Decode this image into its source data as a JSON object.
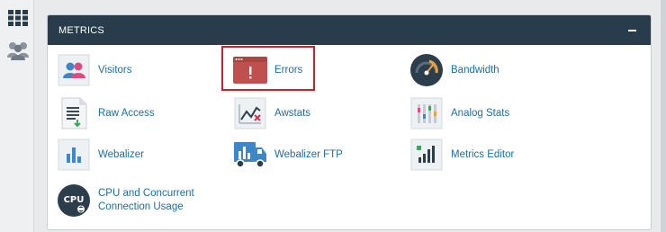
{
  "sidebar": {
    "items": [
      {
        "icon": "grid-icon"
      },
      {
        "icon": "users-icon"
      }
    ]
  },
  "panel": {
    "title": "METRICS",
    "collapse_icon": "minus-icon"
  },
  "metrics": [
    {
      "label": "Visitors",
      "icon": "visitors-icon"
    },
    {
      "label": "Errors",
      "icon": "errors-icon"
    },
    {
      "label": "Bandwidth",
      "icon": "bandwidth-icon"
    },
    {
      "label": "Raw Access",
      "icon": "raw-access-icon"
    },
    {
      "label": "Awstats",
      "icon": "awstats-icon"
    },
    {
      "label": "Analog Stats",
      "icon": "analog-stats-icon"
    },
    {
      "label": "Webalizer",
      "icon": "webalizer-icon"
    },
    {
      "label": "Webalizer FTP",
      "icon": "webalizer-ftp-icon"
    },
    {
      "label": "Metrics Editor",
      "icon": "metrics-editor-icon"
    },
    {
      "label": "CPU and Concurrent Connection Usage",
      "icon": "cpu-icon"
    }
  ],
  "cpu_icon_text": "CPU",
  "colors": {
    "header": "#283c4b",
    "link": "#1c6ea4",
    "highlight": "#d31c23",
    "error_tile": "#c0504d"
  }
}
